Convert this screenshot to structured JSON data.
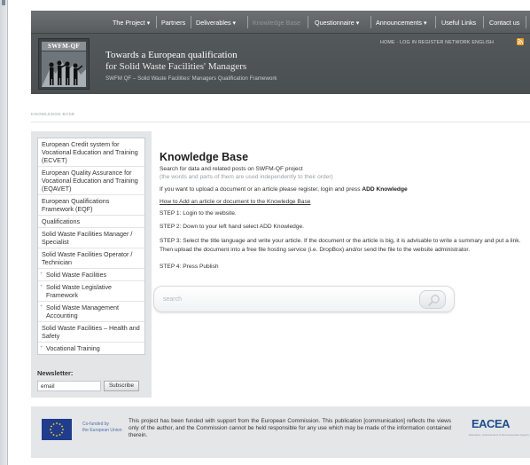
{
  "nav": {
    "items": [
      {
        "label": "The Project ▾"
      },
      {
        "label": "Partners"
      },
      {
        "label": "Deliverables ▾"
      },
      {
        "label": "Knowledge Base"
      },
      {
        "label": "Questionnaire ▾"
      },
      {
        "label": "Announcements ▾"
      },
      {
        "label": "Useful Links"
      },
      {
        "label": "Contact us"
      }
    ]
  },
  "header": {
    "logo_text": "SWFM-QF",
    "title_line1": "Towards a European qualification",
    "title_line2": "for Solid Waste Facilities' Managers",
    "subtitle": "SWFM QF – Solid Waste Facilities' Managers Qualification Framework",
    "top_links": "HOME · LOG IN  REGISTER  NETWORK ENGLISH"
  },
  "breadcrumb": "KNOWLEDGE BASE",
  "sidebar": {
    "items": [
      {
        "label": "European Credit system for Vocational Education and Training (ECVET)",
        "expandable": false
      },
      {
        "label": "European Quality Assurance for Vocational Education and Training (EQAVET)",
        "expandable": false
      },
      {
        "label": "European Qualifications Framework (EQF)",
        "expandable": false
      },
      {
        "label": "Qualifications",
        "expandable": false
      },
      {
        "label": "Solid Waste Facilities Manager / Specialist",
        "expandable": false
      },
      {
        "label": "Solid Waste Facilities Operator / Technician",
        "expandable": false
      },
      {
        "label": "Solid Waste Facilities",
        "expandable": true
      },
      {
        "label": "Solid Waste Legislative Framework",
        "expandable": true
      },
      {
        "label": "Solid Waste Management Accounting",
        "expandable": true
      },
      {
        "label": "Solid Waste Facilities – Health and Safety",
        "expandable": false
      },
      {
        "label": "Vocational Training",
        "expandable": true
      }
    ],
    "newsletter_label": "Newsletter:",
    "email_value": "email",
    "subscribe_label": "Subscribe"
  },
  "main": {
    "title": "Knowledge Base",
    "search_desc": "Search for data and related posts on SWFM-QF project",
    "search_hint": "(the words and parts of them are used independently to their order)",
    "upload_text_prefix": "If you want to upload a document or an article please register, login and press ",
    "upload_text_bold": "ADD Knowledge",
    "howto_link": "How to Add an article or document to the Knowledge Base",
    "step1": "STEP 1: Login to the website.",
    "step2": "STEP 2: Down to your left hand select ADD Knowledge.",
    "step3": "STEP 3: Select the title language and write your article. If the document or the article is big, it is advisable to write a summary and put a link. Then upload the document into a free file hosting service (i.e. DropBox) and/or send the file to the website administrator.",
    "step4": "STEP 4: Press Publish",
    "search_placeholder": "search"
  },
  "footer": {
    "eu_line1": "Co-funded by",
    "eu_line2": "the European Union",
    "text": "This project has been funded with support from the European Commission. This publication [communication] reflects the views only of the author, and the Commission cannot be held responsible for any use which may be made of the information contained therein.",
    "eacea_logo": "EACEA",
    "eacea_sub": "Education, Audiovisual & Culture Executive Agency"
  },
  "colors": {
    "header_bg": "#4d5255",
    "nav_text": "#ffffff",
    "rss": "#f39a1e",
    "eu_blue": "#1f3c8f",
    "eu_star": "#ffdd00",
    "eacea_blue": "#1d4e8f"
  },
  "icons": {
    "rss": "rss-icon",
    "search": "magnifier-icon",
    "eu_flag": "eu-flag-icon"
  }
}
